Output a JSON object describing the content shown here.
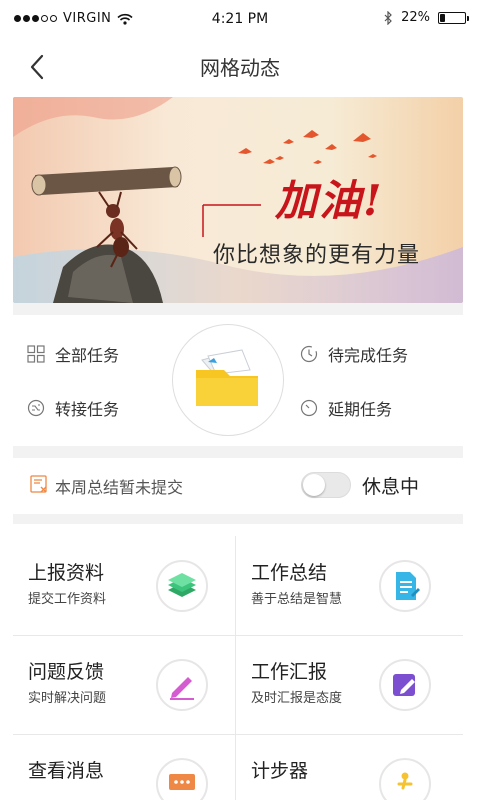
{
  "status_bar": {
    "carrier": "VIRGIN",
    "time": "4:21 PM",
    "battery": "22%",
    "battery_level": 0.22,
    "icons": [
      "signal-dots",
      "wifi-icon",
      "bluetooth-icon",
      "battery-icon"
    ]
  },
  "nav": {
    "title": "网格动态",
    "back_icon": "chevron-left-icon"
  },
  "banner": {
    "title": "加油!",
    "subtitle": "你比想象的更有力量"
  },
  "tasks": {
    "all_tasks": "全部任务",
    "pending_tasks": "待完成任务",
    "transferred_tasks": "转接任务",
    "delayed_tasks": "延期任务"
  },
  "summary": {
    "notice": "本周总结暂未提交",
    "status_label": "休息中",
    "toggle_on": false
  },
  "grid": {
    "items": [
      {
        "title": "上报资料",
        "subtitle": "提交工作资料",
        "icon": "layers-icon"
      },
      {
        "title": "工作总结",
        "subtitle": "善于总结是智慧",
        "icon": "document-icon"
      },
      {
        "title": "问题反馈",
        "subtitle": "实时解决问题",
        "icon": "pen-icon"
      },
      {
        "title": "工作汇报",
        "subtitle": "及时汇报是态度",
        "icon": "edit-icon"
      },
      {
        "title": "查看消息",
        "subtitle": "",
        "icon": "message-icon"
      },
      {
        "title": "计步器",
        "subtitle": "",
        "icon": "walker-icon"
      }
    ]
  },
  "colors": {
    "accent_red": "#c8151b",
    "green": "#3cc47c",
    "blue": "#35b6e6",
    "pink": "#d55cd0",
    "purple": "#7b4fd0",
    "orange": "#ee8844",
    "folder_yellow": "#f7c623"
  }
}
